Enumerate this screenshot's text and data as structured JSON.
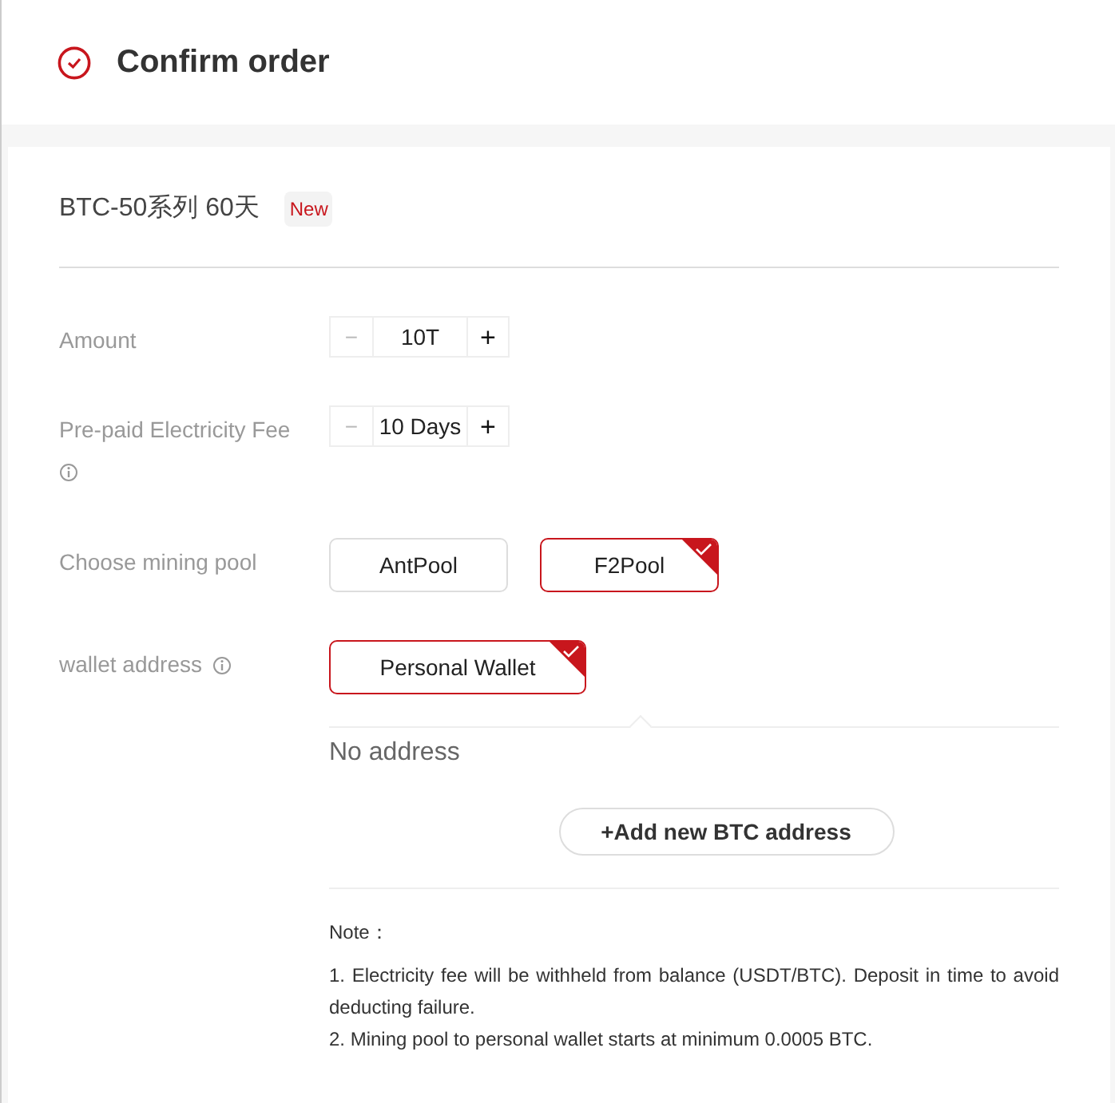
{
  "header": {
    "title": "Confirm order"
  },
  "product": {
    "name": "BTC-50系列 60天",
    "badge": "New"
  },
  "amount": {
    "label": "Amount",
    "minus": "−",
    "value": "10T",
    "plus": "+"
  },
  "electricity": {
    "label": "Pre-paid Electricity Fee",
    "minus": "−",
    "value": "10 Days",
    "plus": "+"
  },
  "mining_pool": {
    "label": "Choose mining pool",
    "options": [
      {
        "label": "AntPool",
        "selected": false
      },
      {
        "label": "F2Pool",
        "selected": true
      }
    ]
  },
  "wallet": {
    "label": "wallet address",
    "options": [
      {
        "label": "Personal Wallet",
        "selected": true
      }
    ],
    "empty_text": "No address",
    "add_button": "+Add new BTC address"
  },
  "note": {
    "title": "Note：",
    "lines": [
      "1. Electricity fee will be withheld from balance (USDT/BTC). Deposit in time to avoid deducting failure.",
      "2. Mining pool to personal wallet starts at minimum 0.0005 BTC."
    ]
  }
}
